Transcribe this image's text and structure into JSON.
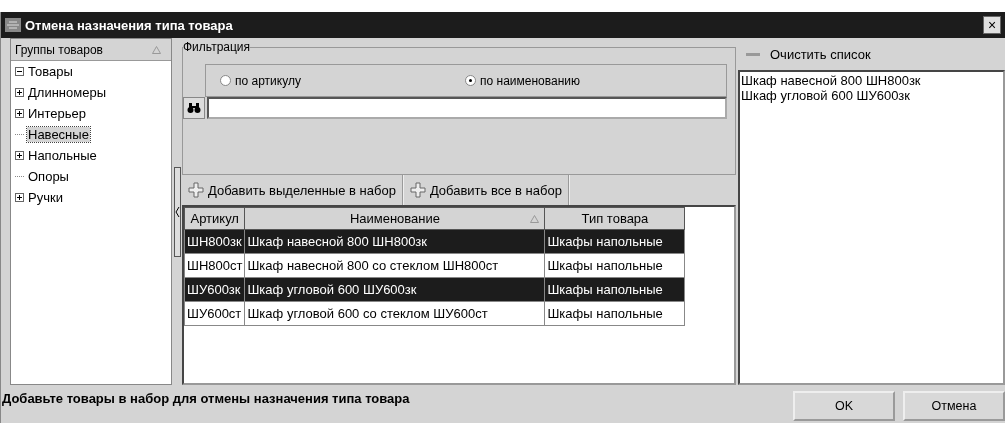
{
  "window": {
    "title": "Отмена назначения типа товара",
    "close": "×"
  },
  "groups": {
    "header": "Группы товаров",
    "sorted": true,
    "tree": [
      {
        "label": "Товары",
        "expandable": true,
        "expanded": true,
        "selected": false,
        "children": [
          {
            "label": "Длинномеры",
            "expandable": true,
            "selected": false
          },
          {
            "label": "Интерьер",
            "expandable": true,
            "selected": false
          },
          {
            "label": "Навесные",
            "expandable": false,
            "selected": true
          },
          {
            "label": "Напольные",
            "expandable": true,
            "selected": false
          },
          {
            "label": "Опоры",
            "expandable": false,
            "selected": false
          },
          {
            "label": "Ручки",
            "expandable": true,
            "selected": false
          }
        ]
      }
    ]
  },
  "filter": {
    "title": "Фильтрация",
    "options": [
      {
        "label": "по артикулу",
        "selected": false
      },
      {
        "label": "по наименованию",
        "selected": true
      }
    ]
  },
  "toolbar": [
    "Добавить выделенные в набор",
    "Добавить все в набор"
  ],
  "table": {
    "columns": [
      {
        "label": "Артикул",
        "sorted": false
      },
      {
        "label": "Наименование",
        "sorted": true
      },
      {
        "label": "Тип товара",
        "sorted": false
      }
    ],
    "rows": [
      {
        "cells": [
          "ШН800зк",
          "Шкаф навесной 800 ШН800зк",
          "Шкафы напольные"
        ],
        "selected": true
      },
      {
        "cells": [
          "ШН800ст",
          "Шкаф навесной 800 со стеклом ШН800ст",
          "Шкафы напольные"
        ],
        "selected": false
      },
      {
        "cells": [
          "ШУ600зк",
          "Шкаф угловой 600 ШУ600зк",
          "Шкафы напольные"
        ],
        "selected": true
      },
      {
        "cells": [
          "ШУ600ст",
          "Шкаф угловой 600 со стеклом ШУ600ст",
          "Шкафы напольные"
        ],
        "selected": false
      }
    ]
  },
  "set": {
    "clear_button": "Очистить список",
    "items": [
      "Шкаф навесной 800 ШН800зк",
      "Шкаф угловой 600 ШУ600зк"
    ]
  },
  "status_bar": "Добавьте товары в набор для отмены назначения типа товара",
  "buttons": [
    "OK",
    "Отмена"
  ]
}
